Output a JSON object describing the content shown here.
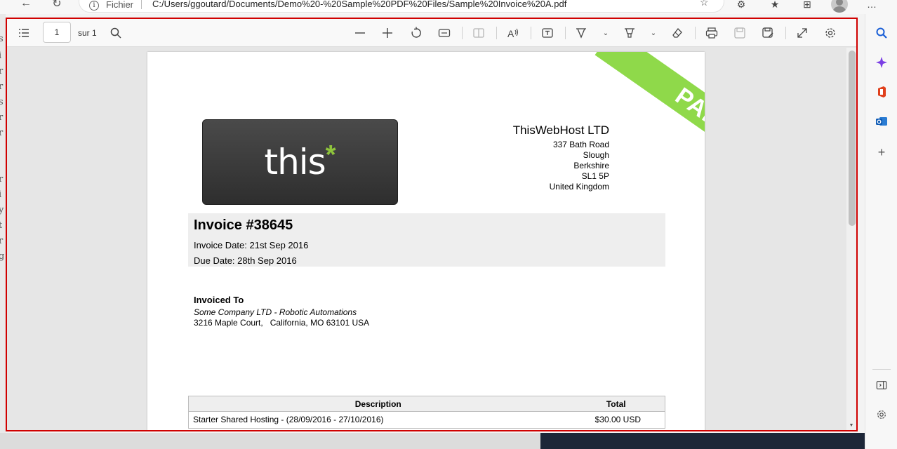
{
  "browser": {
    "nav": {
      "back_icon": "arrow-left-icon",
      "refresh_icon": "refresh-icon"
    },
    "address": {
      "info_icon_glyph": "i",
      "scheme_label": "Fichier",
      "url": "C:/Users/ggoutard/Documents/Demo%20-%20Sample%20PDF%20Files/Sample%20Invoice%20A.pdf"
    },
    "toolbar_icons": [
      "favorites-add-icon",
      "extensions-icon",
      "favorites-icon",
      "collections-icon",
      "profile-avatar",
      "more-icon"
    ],
    "more_glyph": "…"
  },
  "pdf_toolbar": {
    "contents_icon": "table-of-contents-icon",
    "page_current": "1",
    "page_total_label": "sur 1",
    "search_icon": "search-icon",
    "tools": [
      "zoom-out-icon",
      "zoom-in-icon",
      "rotate-icon",
      "fit-width-icon",
      "page-view-icon",
      "read-aloud-icon",
      "text-box-icon",
      "draw-icon",
      "highlight-icon",
      "eraser-icon",
      "print-icon",
      "save-icon",
      "save-as-icon",
      "fullscreen-icon",
      "settings-icon"
    ]
  },
  "invoice": {
    "stamp": "PAID",
    "logo_text": "this",
    "logo_star": "*",
    "company": {
      "name": "ThisWebHost LTD",
      "lines": [
        "337 Bath Road",
        "Slough",
        "Berkshire",
        "SL1 5P",
        "United Kingdom"
      ]
    },
    "title": "Invoice #38645",
    "invoice_date": "Invoice Date: 21st Sep 2016",
    "due_date": "Due Date: 28th Sep 2016",
    "billed": {
      "heading": "Invoiced To",
      "company": "Some Company LTD - Robotic Automations",
      "address": "3216 Maple Court,   California, MO 63101 USA"
    },
    "table": {
      "headers": {
        "description": "Description",
        "total": "Total"
      },
      "rows": [
        {
          "description": "Starter Shared Hosting - (28/09/2016 - 27/10/2016)",
          "total": "$30.00 USD"
        }
      ]
    }
  },
  "sidebar": {
    "icons": [
      "search-icon",
      "copilot-icon",
      "office-icon",
      "outlook-icon",
      "add-icon",
      "sidebar-toggle-icon",
      "settings-icon"
    ]
  },
  "colors": {
    "frame_border": "#d00000",
    "paid_green": "#8fd94a",
    "logo_accent": "#8fc53c"
  }
}
